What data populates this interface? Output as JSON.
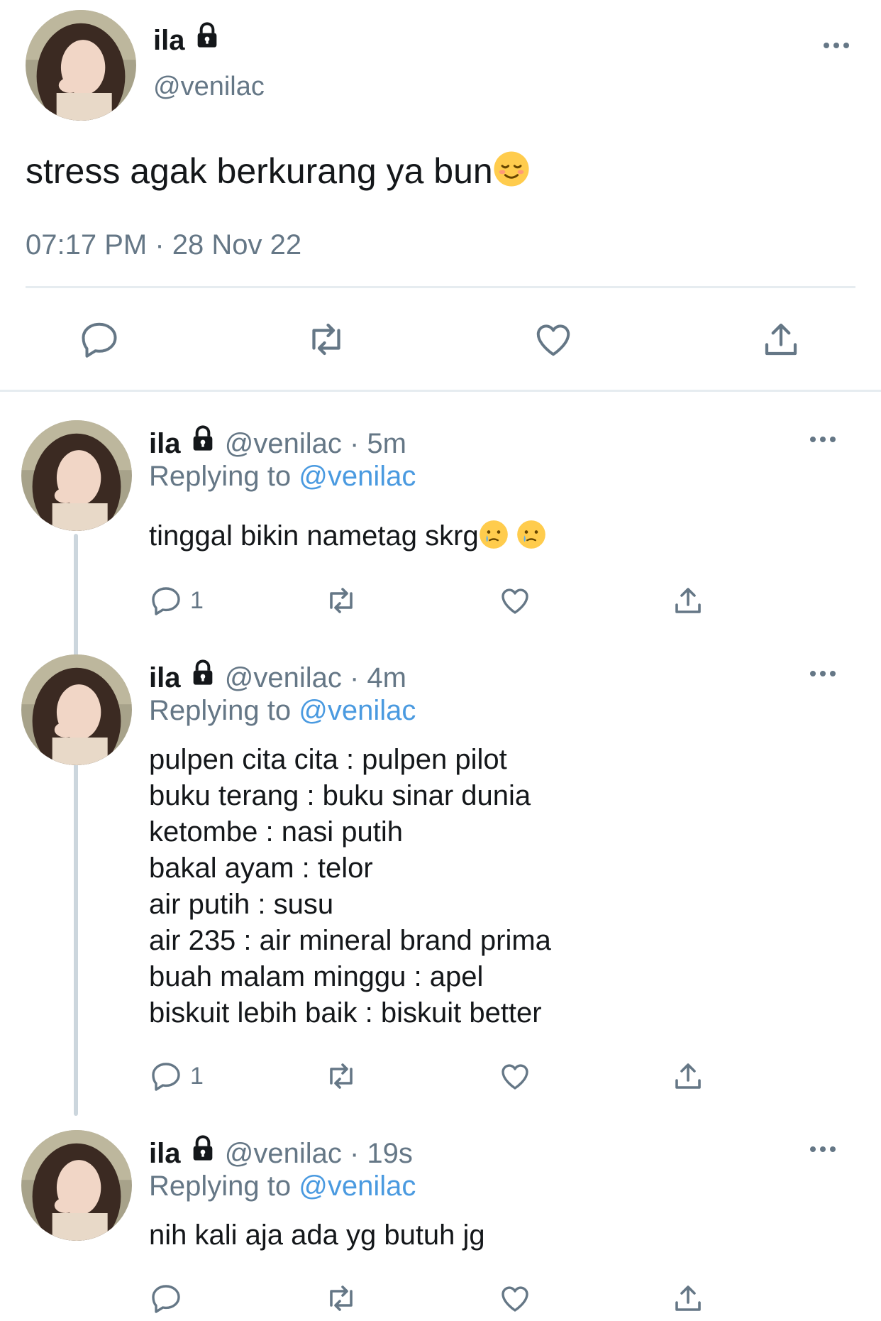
{
  "main_tweet": {
    "name": "ila",
    "handle": "@venilac",
    "text": "stress agak berkurang ya bun",
    "emoji": "relieved-face",
    "timestamp": "07:17 PM · 28 Nov 22"
  },
  "replies": [
    {
      "name": "ila",
      "handle_time": "@venilac · 5m",
      "replying_prefix": "Replying to",
      "replying_to": "@venilac",
      "lines": [
        "tinggal bikin nametag skrg"
      ],
      "emoji": "crying-face",
      "reply_count": "1"
    },
    {
      "name": "ila",
      "handle_time": "@venilac · 4m",
      "replying_prefix": "Replying to",
      "replying_to": "@venilac",
      "lines": [
        "pulpen cita cita : pulpen pilot",
        "buku terang : buku sinar dunia",
        "ketombe : nasi putih",
        "bakal ayam : telor",
        "air putih : susu",
        "air 235 : air mineral brand prima",
        "buah malam minggu : apel",
        "biskuit lebih baik : biskuit better"
      ],
      "reply_count": "1"
    },
    {
      "name": "ila",
      "handle_time": "@venilac · 19s",
      "replying_prefix": "Replying to",
      "replying_to": "@venilac",
      "lines": [
        "nih kali aja ada yg butuh jg"
      ],
      "reply_count": ""
    }
  ],
  "colors": {
    "text": "#14171a",
    "secondary": "#657786",
    "link": "#4a9ae0",
    "divider": "#e6ecf0",
    "thread_line": "#ccd6dd"
  }
}
